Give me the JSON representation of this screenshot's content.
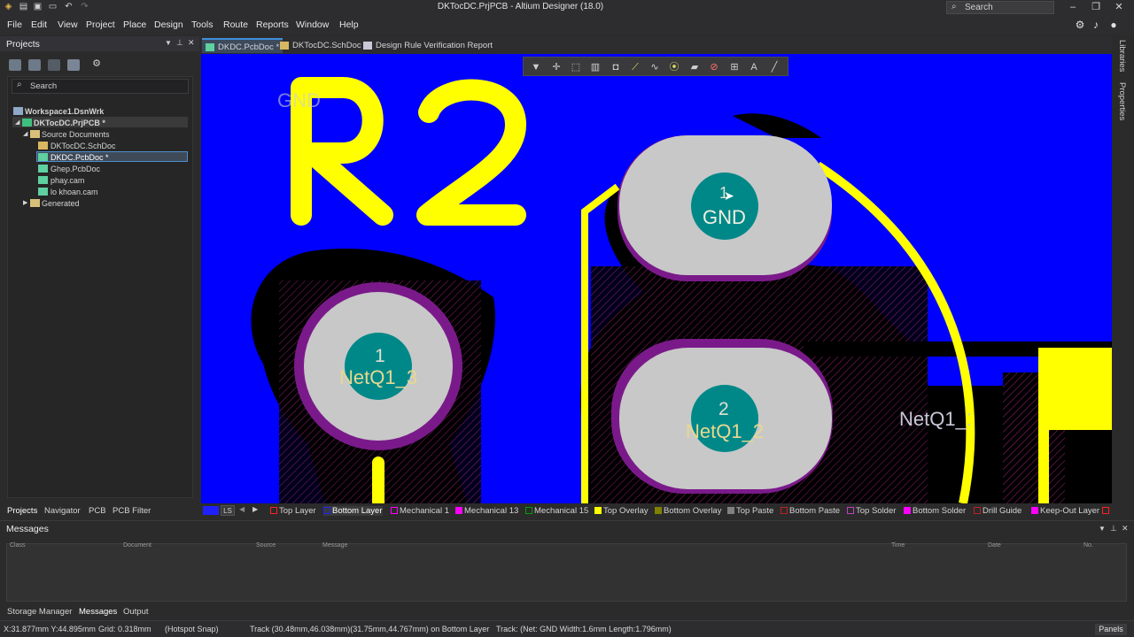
{
  "window": {
    "title": "DKTocDC.PrjPCB - Altium Designer (18.0)",
    "search_placeholder": "Search"
  },
  "menu": [
    "File",
    "Edit",
    "View",
    "Project",
    "Place",
    "Design",
    "Tools",
    "Route",
    "Reports",
    "Window",
    "Help"
  ],
  "projects_panel": {
    "title": "Projects",
    "search_placeholder": "Search",
    "tree": {
      "workspace": "Workspace1.DsnWrk",
      "project": "DKTocDC.PrjPCB *",
      "source_folder": "Source Documents",
      "files": [
        "DKTocDC.SchDoc",
        "DKDC.PcbDoc *",
        "Ghep.PcbDoc",
        "phay.cam",
        "lo khoan.cam"
      ],
      "generated_folder": "Generated"
    },
    "tabs": [
      "Projects",
      "Navigator",
      "PCB",
      "PCB Filter"
    ]
  },
  "doc_tabs": [
    "DKDC.PcbDoc *",
    "DKTocDC.SchDoc",
    "Design Rule Verification Report"
  ],
  "right_strip": [
    "Libraries",
    "Properties"
  ],
  "canvas": {
    "designator": "R2",
    "pads": [
      {
        "number": "1",
        "net": "NetQ1_3"
      },
      {
        "number": "1",
        "net": "GND"
      },
      {
        "number": "2",
        "net": "NetQ1_2"
      }
    ],
    "overlay_gnd_label": "GND",
    "net_label_right": "NetQ1_1"
  },
  "layer_bar": {
    "ls_label": "LS",
    "layers": [
      {
        "name": "Top Layer",
        "color": "#ff2020"
      },
      {
        "name": "Bottom Layer",
        "color": "#2020ff"
      },
      {
        "name": "Mechanical 1",
        "color": "#ff00ff"
      },
      {
        "name": "Mechanical 13",
        "color": "#ff00ff"
      },
      {
        "name": "Mechanical 15",
        "color": "#00a000"
      },
      {
        "name": "Top Overlay",
        "color": "#ffff00"
      },
      {
        "name": "Bottom Overlay",
        "color": "#808000"
      },
      {
        "name": "Top Paste",
        "color": "#808080"
      },
      {
        "name": "Bottom Paste",
        "color": "#800000"
      },
      {
        "name": "Top Solder",
        "color": "#800080"
      },
      {
        "name": "Bottom Solder",
        "color": "#ff00ff"
      },
      {
        "name": "Drill Guide",
        "color": "#800000"
      },
      {
        "name": "Keep-Out Layer",
        "color": "#ff00ff"
      }
    ]
  },
  "messages": {
    "title": "Messages",
    "columns": [
      "Class",
      "Document",
      "Source",
      "Message",
      "Time",
      "Date",
      "No."
    ]
  },
  "bottom_tabs": [
    "Storage Manager",
    "Messages",
    "Output"
  ],
  "status": {
    "coords": "X:31.877mm Y:44.895mm",
    "grid": "Grid: 0.318mm",
    "snap": "(Hotspot Snap)",
    "track": "Track (30.48mm,46.038mm)(31.75mm,44.767mm) on Bottom Layer",
    "track_info": "Track: (Net: GND Width:1.6mm Length:1.796mm)",
    "panels_label": "Panels"
  }
}
